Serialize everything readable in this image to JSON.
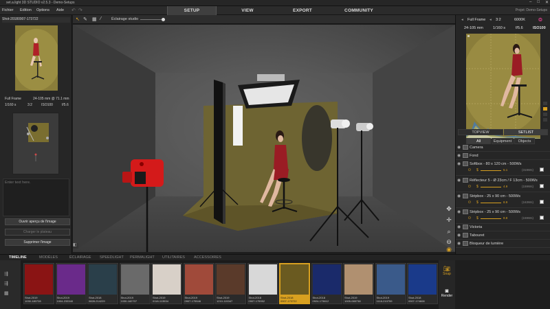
{
  "window": {
    "title": "set.a.light 3D STUDIO v2.5.3 - Demo-Setups"
  },
  "menu": {
    "items": [
      "Fichier",
      "Edition",
      "Options",
      "Aide"
    ]
  },
  "nav": {
    "tabs": [
      "SETUP",
      "VIEW",
      "EXPORT",
      "COMMUNITY"
    ],
    "active": "SETUP"
  },
  "project_label": "Projet: Demo-Setups",
  "toolbar": {
    "lighting_label": "Éclairage studio"
  },
  "left": {
    "shot_title": "Shot-20180907-173722",
    "format": "Full Frame",
    "lens": "24-105 mm @ 71.1 mm",
    "shutter": "1/160 s",
    "ratio": "3:2",
    "iso": "ISO100",
    "aperture": "f/5.6",
    "notes_placeholder": "Enter text here.",
    "btn_open": "Ouvrir aperçu de l'image",
    "btn_load": "Charger le plateau",
    "btn_delete": "Supprimer l'image"
  },
  "camera": {
    "format": "Full Frame",
    "ratio": "3:2",
    "kelvin": "6000K",
    "lens": "24-105 mm",
    "shutter": "1/160 s",
    "aperture": "f/5.6",
    "iso": "ISO100"
  },
  "panel": {
    "tabs": [
      "TOPVIEW",
      "SETLIST"
    ],
    "subtabs": [
      "All",
      "Equipment",
      "Objects"
    ],
    "items": [
      {
        "name": "Camera"
      },
      {
        "name": "Fond"
      },
      {
        "name": "Softbox - 80 x 120 cm - 500Ws",
        "value": "5.1",
        "watts": "(319Ws)"
      },
      {
        "name": "Réflecteur 5 - Ø 23cm / F 13cm - 500Ws",
        "value": "4.9",
        "watts": "(159Ws)"
      },
      {
        "name": "Stripbox - 25 x 90 cm - 500Ws",
        "value": "8.9",
        "watts": "(163Ws)"
      },
      {
        "name": "Stripbox - 25 x 90 cm - 500Ws",
        "value": "8.8",
        "watts": "(159Ws)"
      },
      {
        "name": "Victoria"
      },
      {
        "name": "Tabouret"
      },
      {
        "name": "Bloqueur de lumière"
      }
    ]
  },
  "bottom": {
    "tabs": [
      "TIMELINE",
      "MODÈLES",
      "ÉCLAIRAGE",
      "SPEEDLIGHT",
      "PERMALIGHT",
      "UTILITAIRES",
      "ACCESSOIRES"
    ],
    "active": "TIMELINE",
    "snap_label": "Snap",
    "render_label": "Render"
  },
  "timeline": [
    {
      "l1": "Shot-2019",
      "l2": "1030-180728",
      "color": "#8a1414"
    },
    {
      "l1": "Shot-2019",
      "l2": "1004-233340",
      "color": "#6a2a8a"
    },
    {
      "l1": "Shot-2018",
      "l2": "0828-214229",
      "color": "#2a3f4a"
    },
    {
      "l1": "Shot-2019",
      "l2": "1030-182707",
      "color": "#6a6a6a"
    },
    {
      "l1": "Shot-2019",
      "l2": "0118-113534",
      "color": "#d8d0c8"
    },
    {
      "l1": "Shot-2019",
      "l2": "0907-175546",
      "color": "#a04a3a"
    },
    {
      "l1": "Shot-2019",
      "l2": "1210-115347",
      "color": "#5a3a2a"
    },
    {
      "l1": "Shot-2018",
      "l2": "0907-175952",
      "color": "#d8d8d8"
    },
    {
      "l1": "Shot-2018",
      "l2": "0907-173722",
      "color": "#6a5a20"
    },
    {
      "l1": "Shot-2018",
      "l2": "0924-173612",
      "color": "#1a2a6a"
    },
    {
      "l1": "Shot-2019",
      "l2": "1005-065738",
      "color": "#b09070"
    },
    {
      "l1": "Shot-2019",
      "l2": "1118-210759",
      "color": "#3a5a8a"
    },
    {
      "l1": "Shot-2018",
      "l2": "0907-174608",
      "color": "#1a3a8a"
    }
  ],
  "timeline_selected": 8,
  "colors": {
    "accent": "#d8a020",
    "backdrop": "#8a7d3a",
    "flash_red": "#e02020"
  }
}
